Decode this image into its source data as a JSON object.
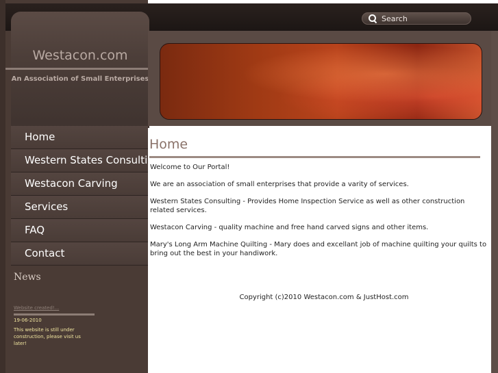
{
  "search": {
    "placeholder": "Search"
  },
  "header": {
    "site_title": "Westacon.com",
    "subtitle": "An Association of Small Enterprises"
  },
  "nav": {
    "items": [
      {
        "label": "Home"
      },
      {
        "label": "Western States Consulting"
      },
      {
        "label": "Westacon Carving"
      },
      {
        "label": "Services"
      },
      {
        "label": "FAQ"
      },
      {
        "label": "Contact"
      }
    ]
  },
  "news": {
    "title": "News",
    "link": "Website created!...",
    "date": "19-06-2010",
    "body": "This website is still under construction, please visit us later!"
  },
  "main": {
    "title": "Home",
    "paragraphs": [
      "Welcome to Our Portal!",
      "We are an association of small enterprises that provide a varity of services.",
      "Western States Consulting - Provides Home Inspection Service as well as other construction related services.",
      "Westacon Carving - quality machine and free hand carved signs and other items.",
      "Mary's Long Arm Machine Quilting - Mary does and excellant job of machine quilting your quilts to bring out the best in your handiwork."
    ],
    "copyright": "Copyright (c)2010 Westacon.com & JustHost.com"
  },
  "colors": {
    "sidebar_bg": "#4a3b35",
    "accent_text": "#8a7269",
    "news_text": "#f2e6a0"
  }
}
